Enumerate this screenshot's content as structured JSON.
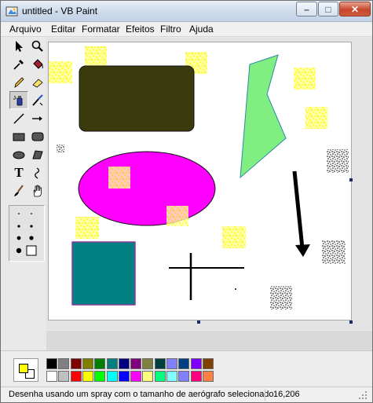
{
  "window": {
    "title": "untitled - VB Paint"
  },
  "window_controls": {
    "min_symbol": "–",
    "max_symbol": "□",
    "close_symbol": "✕"
  },
  "menu": [
    "Arquivo",
    "Editar",
    "Formatar",
    "Efeitos",
    "Filtro",
    "Ajuda"
  ],
  "tools": [
    {
      "name": "select-arrow",
      "icon": "arrow-pointer-icon"
    },
    {
      "name": "zoom",
      "icon": "magnifier-icon"
    },
    {
      "name": "color-picker",
      "icon": "eyedropper-icon"
    },
    {
      "name": "fill-bucket",
      "icon": "paint-bucket-icon"
    },
    {
      "name": "pencil",
      "icon": "pencil-icon"
    },
    {
      "name": "eraser",
      "icon": "eraser-icon"
    },
    {
      "name": "airbrush",
      "icon": "spray-can-icon",
      "selected": true
    },
    {
      "name": "color-replace",
      "icon": "brush-replace-icon"
    },
    {
      "name": "line",
      "icon": "line-icon"
    },
    {
      "name": "arrow-line",
      "icon": "arrow-line-icon"
    },
    {
      "name": "rectangle",
      "icon": "rectangle-icon"
    },
    {
      "name": "rounded-rectangle",
      "icon": "rounded-rectangle-icon"
    },
    {
      "name": "ellipse",
      "icon": "ellipse-icon"
    },
    {
      "name": "polygon",
      "icon": "polygon-icon"
    },
    {
      "name": "text",
      "icon": "text-icon",
      "label": "T"
    },
    {
      "name": "curve",
      "icon": "curve-icon"
    },
    {
      "name": "brush",
      "icon": "paintbrush-icon"
    },
    {
      "name": "hand",
      "icon": "hand-icon"
    }
  ],
  "palette": {
    "foreground": "#FFFF00",
    "background": "#FFFFFF",
    "colors": [
      "#000000",
      "#808080",
      "#800000",
      "#808000",
      "#008000",
      "#008080",
      "#000080",
      "#800080",
      "#808040",
      "#004040",
      "#8080FF",
      "#004080",
      "#8000FF",
      "#804000",
      "#FFFFFF",
      "#C0C0C0",
      "#FF0000",
      "#FFFF00",
      "#00FF00",
      "#00FFFF",
      "#0000FF",
      "#FF00FF",
      "#FFFF80",
      "#00FF80",
      "#80FFFF",
      "#8080FF",
      "#FF0080",
      "#FF8040"
    ]
  },
  "status": {
    "message": "Desenha usando um spray com o tamanho de aerógrafo selecionado",
    "coords": "16,206"
  },
  "colors": {
    "rounded_rect": "#3a3a0c",
    "polygon": "#80ee80",
    "ellipse": "#ff00ff",
    "square": "#008080",
    "square_border": "#8e3a9e",
    "spray_yellow": "#ffff00",
    "arrow": "#000000"
  }
}
